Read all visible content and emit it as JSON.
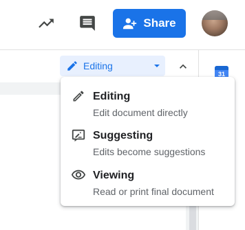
{
  "header": {
    "share_label": "Share",
    "activity_icon": "trending-up-icon",
    "comments_icon": "comment-icon",
    "share_icon": "person-add-icon",
    "accent_color": "#1a73e8"
  },
  "toolbar": {
    "mode_label": "Editing",
    "mode_icon": "pencil-icon",
    "collapse_icon": "chevron-up-icon",
    "calendar_day": "31"
  },
  "mode_menu": {
    "items": [
      {
        "title": "Editing",
        "description": "Edit document directly",
        "icon": "pencil-icon"
      },
      {
        "title": "Suggesting",
        "description": "Edits become suggestions",
        "icon": "suggest-edit-icon"
      },
      {
        "title": "Viewing",
        "description": "Read or print final document",
        "icon": "eye-icon"
      }
    ]
  }
}
